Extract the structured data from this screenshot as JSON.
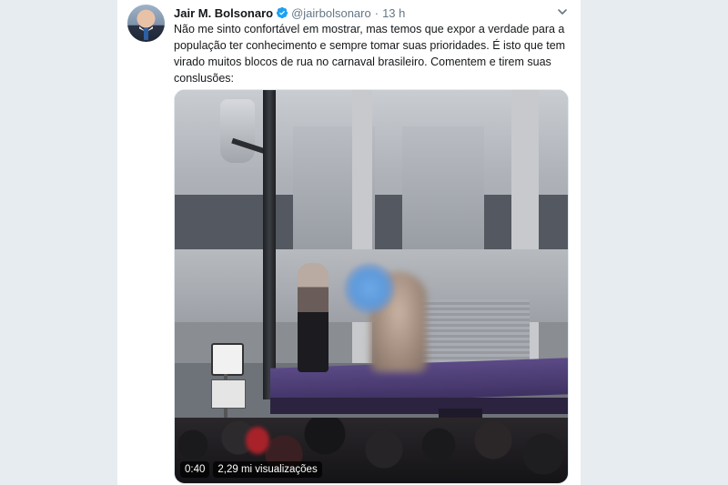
{
  "tweet": {
    "author": {
      "name": "Jair M. Bolsonaro",
      "handle": "@jairbolsonaro",
      "verified": true,
      "avatar_icon": "avatar-photo"
    },
    "separator": "·",
    "time": "13 h",
    "text": "Não me sinto confortável em mostrar, mas temos que expor a verdade para a\npopulação ter conhecimento e sempre tomar suas prioridades. É isto que tem\nvirado muitos blocos de rua no carnaval brasileiro. Comentem e tirem suas\nconslusões:",
    "menu_icon": "chevron-down-icon",
    "media": {
      "type": "video",
      "duration": "0:40",
      "views": "2,29 mi visualizações"
    }
  },
  "colors": {
    "page_background": "#e6ecf0",
    "card_background": "#ffffff",
    "verified_blue": "#1da1f2",
    "secondary_text": "#657786",
    "primary_text": "#14171a"
  }
}
